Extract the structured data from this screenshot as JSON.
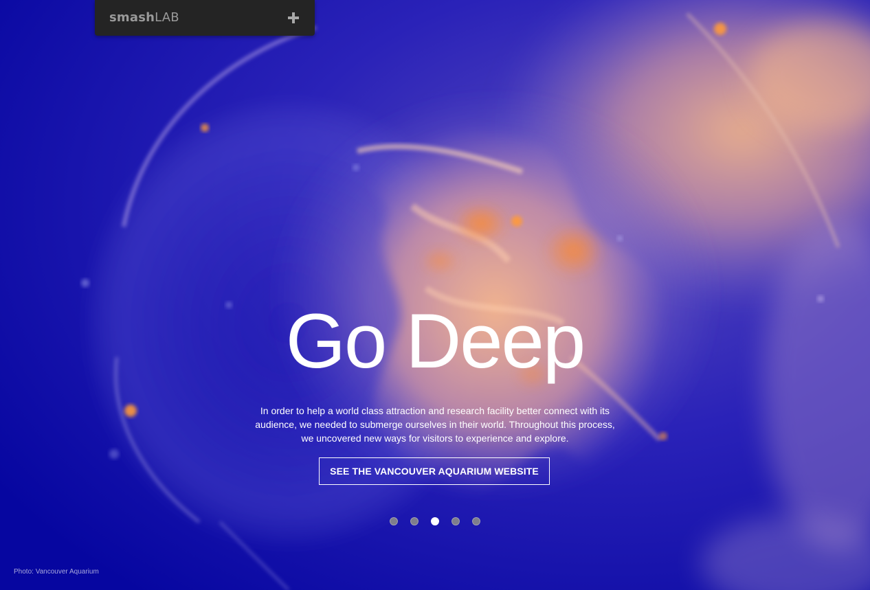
{
  "nav": {
    "logo_smash": "smash",
    "logo_lab": "LAB",
    "menu_icon": "plus-icon"
  },
  "hero": {
    "title": "Go Deep",
    "description_lines": [
      "In order to help a world class attraction and research facility better connect with its",
      "audience, we needed to submerge ourselves in their world. Throughout this process,",
      "we uncovered new ways for visitors to experience and explore."
    ],
    "cta_label": "SEE THE VANCOUVER AQUARIUM WEBSITE"
  },
  "pager": {
    "total": 5,
    "active_index": 2
  },
  "credit": "Photo: Vancouver Aquarium",
  "colors": {
    "background_blue": "#0a0aa6",
    "jelly_orange": "#f0a070",
    "nav_bg": "#242424",
    "text_white": "#ffffff"
  }
}
